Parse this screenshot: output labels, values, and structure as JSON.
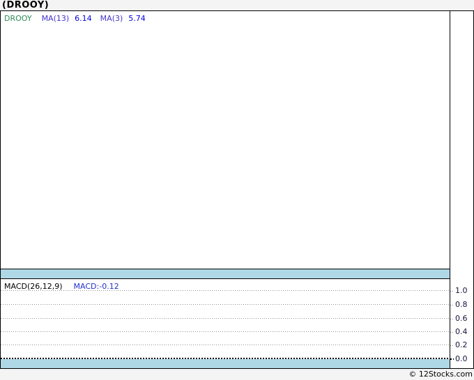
{
  "title": "(DROOY)",
  "main_chart": {
    "legend": {
      "ticker": "DROOY",
      "ma1_label": "MA(13)",
      "ma1_value": "6.14",
      "ma2_label": "MA(3)",
      "ma2_value": "5.74"
    }
  },
  "macd_panel": {
    "legend_label": "MACD(26,12,9)",
    "legend_value": "MACD:-0.12",
    "ticks": [
      "1.0",
      "0.8",
      "0.6",
      "0.4",
      "0.2",
      "0.0"
    ]
  },
  "footer": {
    "credit": "© 12Stocks.com"
  },
  "colors": {
    "page_bg": "#f4f4f4",
    "panel_bg": "#ffffff",
    "border_black": "#000000",
    "band_blue": "#aed8e6",
    "ticker_green": "#2e8b57",
    "ma_label_purple": "#4433cc",
    "value_blue": "#0000e6",
    "macd_value_blue": "#2233cc",
    "axis_label_navy": "#14143c",
    "grid_gray": "#909090"
  },
  "chart_data": {
    "type": "line",
    "title": "(DROOY)",
    "legend_position": "top-left",
    "panels": [
      {
        "name": "price",
        "legend": [
          "DROOY",
          "MA(13)",
          "MA(3)"
        ],
        "visible_values": {
          "MA(13)": 6.14,
          "MA(3)": 5.74
        },
        "series": [],
        "grid": "off"
      },
      {
        "name": "macd",
        "legend": [
          "MACD(26,12,9)",
          "MACD:-0.12"
        ],
        "visible_values": {
          "MACD": -0.12
        },
        "yticks": [
          1.0,
          0.8,
          0.6,
          0.4,
          0.2,
          0.0
        ],
        "ylim": [
          0.0,
          1.0
        ],
        "grid": "dotted-horizontal",
        "series": []
      }
    ]
  }
}
